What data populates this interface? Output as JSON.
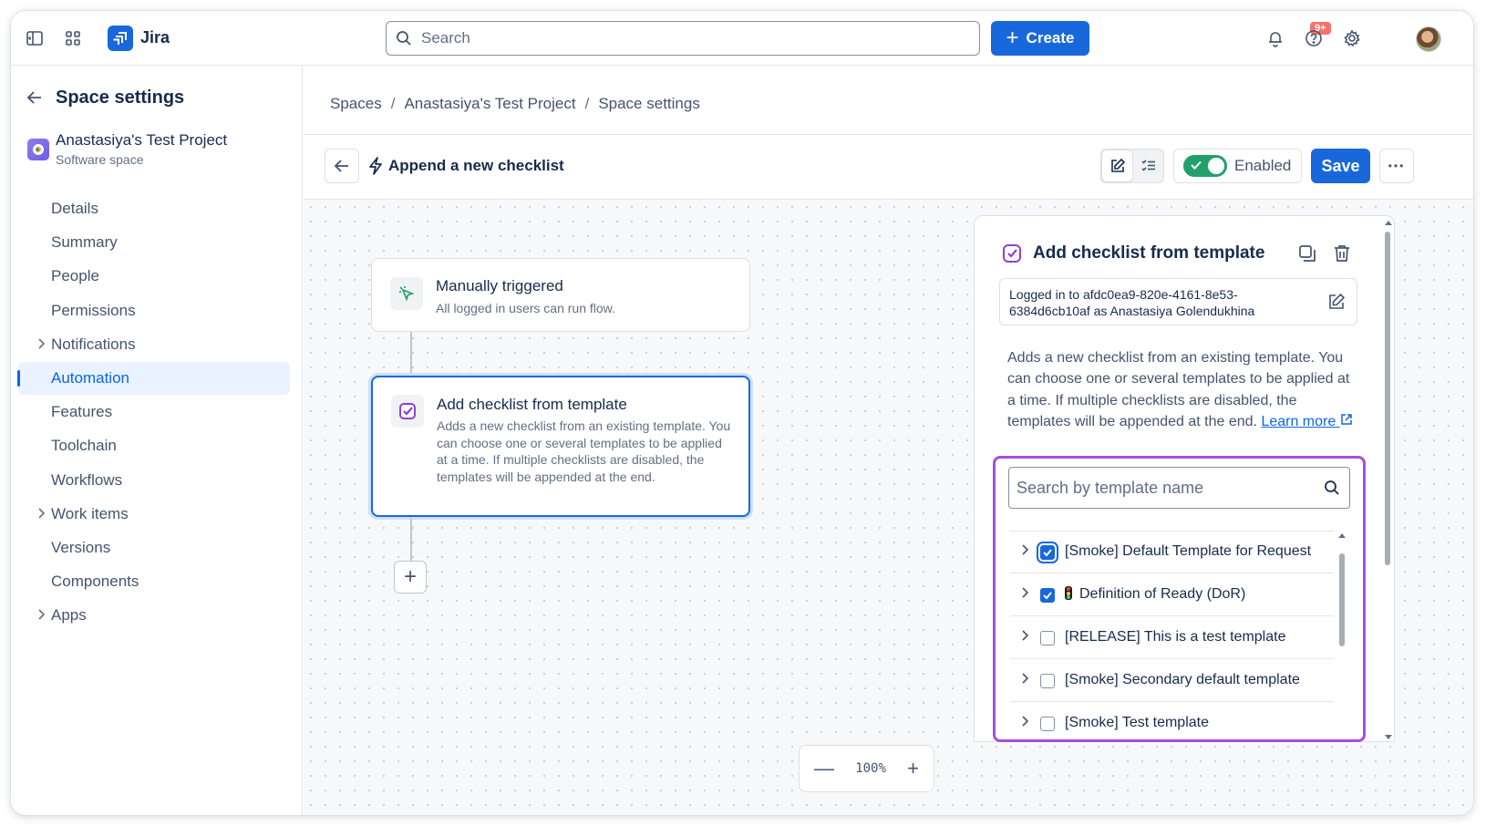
{
  "topbar": {
    "app_name": "Jira",
    "search_placeholder": "Search",
    "create_label": "Create",
    "notification_badge": "9+"
  },
  "sidebar": {
    "title": "Space settings",
    "project_name": "Anastasiya's Test Project",
    "project_type": "Software space",
    "items": [
      {
        "label": "Details",
        "expandable": false,
        "active": false
      },
      {
        "label": "Summary",
        "expandable": false,
        "active": false
      },
      {
        "label": "People",
        "expandable": false,
        "active": false
      },
      {
        "label": "Permissions",
        "expandable": false,
        "active": false
      },
      {
        "label": "Notifications",
        "expandable": true,
        "active": false
      },
      {
        "label": "Automation",
        "expandable": false,
        "active": true
      },
      {
        "label": "Features",
        "expandable": false,
        "active": false
      },
      {
        "label": "Toolchain",
        "expandable": false,
        "active": false
      },
      {
        "label": "Workflows",
        "expandable": false,
        "active": false
      },
      {
        "label": "Work items",
        "expandable": true,
        "active": false
      },
      {
        "label": "Versions",
        "expandable": false,
        "active": false
      },
      {
        "label": "Components",
        "expandable": false,
        "active": false
      },
      {
        "label": "Apps",
        "expandable": true,
        "active": false
      }
    ]
  },
  "breadcrumb": [
    "Spaces",
    "Anastasiya's Test Project",
    "Space settings"
  ],
  "rule": {
    "title": "Append a new checklist",
    "enabled_label": "Enabled",
    "save_label": "Save",
    "more_label": "•••"
  },
  "canvas": {
    "trigger": {
      "title": "Manually triggered",
      "description": "All logged in users can run flow."
    },
    "action": {
      "title": "Add checklist from template",
      "description": "Adds a new checklist from an existing template. You can choose one or several templates to be applied at a time. If multiple checklists are disabled, the templates will be appended at the end."
    },
    "add_step": "+",
    "zoom": {
      "level": "100%",
      "minus": "—",
      "plus": "+"
    }
  },
  "panel": {
    "title": "Add checklist from template",
    "login_text": "Logged in to afdc0ea9-820e-4161-8e53-6384d6cb10af as Anastasiya Golendukhina",
    "description": "Adds a new checklist from an existing template. You can choose one or several templates to be applied at a time. If multiple checklists are disabled, the templates will be appended at the end.",
    "learn_more": "Learn more",
    "template_search_placeholder": "Search by template name",
    "templates": [
      {
        "label": "[Smoke] Default Template for Request",
        "checked": true,
        "icon": ""
      },
      {
        "label": "Definition of Ready (DoR)",
        "checked": true,
        "icon": "traffic-light-icon"
      },
      {
        "label": "[RELEASE] This is a test template",
        "checked": false,
        "icon": ""
      },
      {
        "label": "[Smoke] Secondary default template",
        "checked": false,
        "icon": ""
      },
      {
        "label": "[Smoke] Test template",
        "checked": false,
        "icon": ""
      }
    ]
  },
  "colors": {
    "brand_blue": "#1868db",
    "enabled_green": "#22a06b",
    "highlight_purple": "#a64fd8",
    "notification_red": "#f87168"
  }
}
